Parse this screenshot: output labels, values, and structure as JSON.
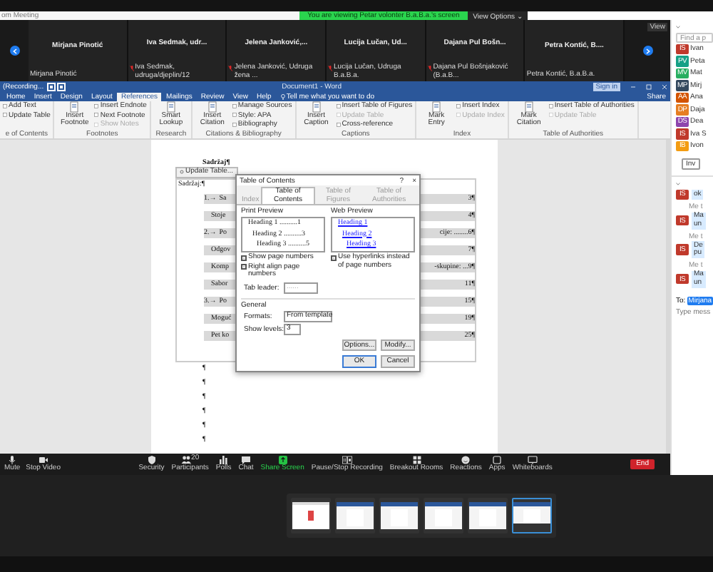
{
  "meeting_bar": {
    "title": "om Meeting",
    "banner": "You are viewing Petar volonter B.a.B.a.'s screen",
    "view_options": "View Options ⌄"
  },
  "gallery": {
    "view": "View",
    "tiles": [
      {
        "name": "Mirjana Pinotić",
        "label": "Mirjana Pinotić",
        "muted": false
      },
      {
        "name": "Iva Sedmak, udr...",
        "label": "Iva Sedmak, udruga/djeplin/12",
        "muted": true
      },
      {
        "name": "Jelena Janković,...",
        "label": "Jelena Janković, Udruga žena ...",
        "muted": true
      },
      {
        "name": "Lucija Lučan, Ud...",
        "label": "Lucija Lučan, Udruga B.a.B.a.",
        "muted": true
      },
      {
        "name": "Dajana Pul Bošn...",
        "label": "Dajana Pul Bošnjaković (B.a.B...",
        "muted": true
      },
      {
        "name": "Petra Kontić, B....",
        "label": "Petra Kontić, B.a.B.a.",
        "muted": false
      }
    ]
  },
  "word": {
    "file_name": "(Recording...",
    "title": "Document1 - Word",
    "sign_in": "Sign in",
    "share": "Share",
    "tell_me": "Tell me what you want to do",
    "tabs": [
      {
        "label": "Home",
        "selected": false
      },
      {
        "label": "Insert",
        "selected": false
      },
      {
        "label": "Design",
        "selected": false
      },
      {
        "label": "Layout",
        "selected": false
      },
      {
        "label": "References",
        "selected": true
      },
      {
        "label": "Mailings",
        "selected": false
      },
      {
        "label": "Review",
        "selected": false
      },
      {
        "label": "View",
        "selected": false
      },
      {
        "label": "Help",
        "selected": false
      }
    ],
    "ribbon_groups": [
      {
        "label": "e of Contents",
        "items": [
          {
            "kind": "small",
            "label": "Add Text",
            "disabled": false
          },
          {
            "kind": "small",
            "label": "Update Table",
            "disabled": false
          }
        ]
      },
      {
        "label": "Footnotes",
        "items": [
          {
            "kind": "large",
            "label": "Insert Footnote",
            "disabled": false
          },
          {
            "kind": "small",
            "label": "Insert Endnote",
            "disabled": false
          },
          {
            "kind": "small",
            "label": "Next Footnote",
            "disabled": false
          },
          {
            "kind": "small",
            "label": "Show Notes",
            "disabled": true
          }
        ]
      },
      {
        "label": "Research",
        "items": [
          {
            "kind": "large",
            "label": "Smart Lookup",
            "disabled": false
          }
        ]
      },
      {
        "label": "Citations & Bibliography",
        "items": [
          {
            "kind": "large",
            "label": "Insert Citation",
            "disabled": false
          },
          {
            "kind": "small",
            "label": "Manage Sources",
            "disabled": false
          },
          {
            "kind": "small",
            "label": "Style: APA",
            "disabled": false
          },
          {
            "kind": "small",
            "label": "Bibliography",
            "disabled": false
          }
        ]
      },
      {
        "label": "Captions",
        "items": [
          {
            "kind": "large",
            "label": "Insert Caption",
            "disabled": false
          },
          {
            "kind": "small",
            "label": "Insert Table of Figures",
            "disabled": false
          },
          {
            "kind": "small",
            "label": "Update Table",
            "disabled": true
          },
          {
            "kind": "small",
            "label": "Cross-reference",
            "disabled": false
          }
        ]
      },
      {
        "label": "Index",
        "items": [
          {
            "kind": "large",
            "label": "Mark Entry",
            "disabled": false
          },
          {
            "kind": "small",
            "label": "Insert Index",
            "disabled": false
          },
          {
            "kind": "small",
            "label": "Update Index",
            "disabled": true
          }
        ]
      },
      {
        "label": "Table of Authorities",
        "items": [
          {
            "kind": "large",
            "label": "Mark Citation",
            "disabled": false
          },
          {
            "kind": "small",
            "label": "Insert Table of Authorities",
            "disabled": false
          },
          {
            "kind": "small",
            "label": "Update Table",
            "disabled": true
          }
        ]
      }
    ]
  },
  "document": {
    "heading": "Sadržaj¶",
    "update_button": "Update Table...",
    "toc_title": "Sadržaj:¶",
    "toc": [
      {
        "kind": "chapter",
        "number": "1.→",
        "left": "Sa",
        "right": "3¶"
      },
      {
        "kind": "section",
        "left": "Stoje",
        "right": "4¶"
      },
      {
        "kind": "chapter",
        "number": "2.→",
        "left": "Po",
        "right": "cije: ........6¶"
      },
      {
        "kind": "section",
        "left": "Odgov",
        "right": "7¶"
      },
      {
        "kind": "section",
        "left": "Komp",
        "right": "-skupine: ...9¶"
      },
      {
        "kind": "section",
        "left": "Sabor",
        "right": "11¶"
      },
      {
        "kind": "chapter",
        "number": "3.→",
        "left": "Po",
        "right": "15¶"
      },
      {
        "kind": "section",
        "left": "Moguć",
        "right": "19¶"
      },
      {
        "kind": "section",
        "left": "Pet ko",
        "right": "25¶"
      }
    ],
    "paragraph_marks": [
      "¶",
      "¶",
      "¶",
      "¶",
      "¶",
      "¶"
    ]
  },
  "dialog": {
    "title": "Table of Contents",
    "help": "?",
    "close": "×",
    "tabs": [
      {
        "label": "Index",
        "selected": false
      },
      {
        "label": "Table of Contents",
        "selected": true
      },
      {
        "label": "Table of Figures",
        "selected": false
      },
      {
        "label": "Table of Authorities",
        "selected": false
      }
    ],
    "print_preview": {
      "label": "Print Preview",
      "lines": [
        "Heading 1 ..........1",
        "Heading 2 ..........3",
        "Heading 3 ..........5"
      ]
    },
    "web_preview": {
      "label": "Web Preview",
      "lines": [
        "Heading 1",
        "Heading 2",
        "Heading 3"
      ]
    },
    "options": [
      {
        "label": "Show page numbers",
        "checked": true
      },
      {
        "label": "Right align page numbers",
        "checked": true
      }
    ],
    "hyperlinks": {
      "label": "Use hyperlinks instead of page numbers",
      "checked": true
    },
    "tab_leader": {
      "label": "Tab leader:",
      "value": "......"
    },
    "general": "General",
    "formats": {
      "label": "Formats:",
      "value": "From template"
    },
    "levels": {
      "label": "Show levels:",
      "value": "3"
    },
    "buttons": [
      "Options...",
      "Modify...",
      "OK",
      "Cancel"
    ]
  },
  "toolbar": {
    "items": [
      {
        "kind": "mic",
        "label": "Mute",
        "active": false
      },
      {
        "kind": "video",
        "label": "Stop Video",
        "active": false
      },
      {
        "kind": "security",
        "label": "Security",
        "active": false
      },
      {
        "kind": "participants",
        "label": "Participants",
        "active": false,
        "count": "20"
      },
      {
        "kind": "polls",
        "label": "Polls",
        "active": false
      },
      {
        "kind": "chat",
        "label": "Chat",
        "active": false
      },
      {
        "kind": "share",
        "label": "Share Screen",
        "active": true
      },
      {
        "kind": "record",
        "label": "Pause/Stop Recording",
        "active": false
      },
      {
        "kind": "rooms",
        "label": "Breakout Rooms",
        "active": false
      },
      {
        "kind": "reactions",
        "label": "Reactions",
        "active": false
      },
      {
        "kind": "apps",
        "label": "Apps",
        "active": false
      },
      {
        "kind": "whiteboard",
        "label": "Whiteboards",
        "active": false
      }
    ],
    "end": "End"
  },
  "thumbnails": [
    {
      "selected": false
    },
    {
      "selected": false
    },
    {
      "selected": false
    },
    {
      "selected": false
    },
    {
      "selected": false
    },
    {
      "selected": true
    }
  ],
  "panel": {
    "search": {
      "placeholder": "Find a p"
    },
    "participants": [
      {
        "initials": "IS",
        "name": "Ivan",
        "color": "#c0392b"
      },
      {
        "initials": "PV",
        "name": "Peta",
        "color": "#16a085"
      },
      {
        "initials": "MV",
        "name": "Mat",
        "color": "#27ae60"
      },
      {
        "initials": "MP",
        "name": "Mirj",
        "color": "#34495e"
      },
      {
        "initials": "AA",
        "name": "Ana",
        "color": "#d35400"
      },
      {
        "initials": "DP",
        "name": "Daja",
        "color": "#e67e22"
      },
      {
        "initials": "DS",
        "name": "Dea",
        "color": "#8e44ad"
      },
      {
        "initials": "IS",
        "name": "Iva S",
        "color": "#c0392b"
      },
      {
        "initials": "IB",
        "name": "Ivon",
        "color": "#f39c12"
      }
    ],
    "invite": "Inv",
    "chat": [
      {
        "initials": "IS",
        "text": "ok"
      },
      {
        "initials": "IS",
        "sender": "Me t",
        "text": "Ma\nun"
      },
      {
        "initials": "IS",
        "sender": "Me t",
        "text": "De\npu"
      },
      {
        "initials": "IS",
        "sender": "Me t",
        "text": "Ma\nun"
      }
    ],
    "to": "To:",
    "recipient": "Mirjana",
    "message": {
      "placeholder": "Type mess"
    }
  }
}
